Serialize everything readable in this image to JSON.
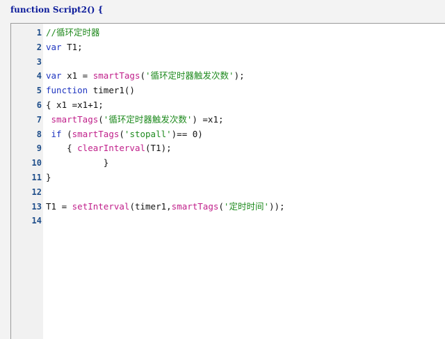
{
  "header": {
    "title": "function Script2() {"
  },
  "editor": {
    "lines": [
      {
        "n": "1",
        "tokens": [
          {
            "t": "//循环定时器",
            "c": "cm"
          }
        ]
      },
      {
        "n": "2",
        "tokens": [
          {
            "t": "var",
            "c": "kw"
          },
          {
            "t": " T1;",
            "c": ""
          }
        ]
      },
      {
        "n": "3",
        "tokens": []
      },
      {
        "n": "4",
        "tokens": [
          {
            "t": "var",
            "c": "kw"
          },
          {
            "t": " x1 = ",
            "c": ""
          },
          {
            "t": "smartTags",
            "c": "fn"
          },
          {
            "t": "(",
            "c": ""
          },
          {
            "t": "'循环定时器触发次数'",
            "c": "st"
          },
          {
            "t": ");",
            "c": ""
          }
        ]
      },
      {
        "n": "5",
        "tokens": [
          {
            "t": "function",
            "c": "kw"
          },
          {
            "t": " timer1()",
            "c": ""
          }
        ]
      },
      {
        "n": "6",
        "tokens": [
          {
            "t": "{ x1 =x1+1;",
            "c": ""
          }
        ]
      },
      {
        "n": "7",
        "tokens": [
          {
            "t": " ",
            "c": ""
          },
          {
            "t": "smartTags",
            "c": "fn"
          },
          {
            "t": "(",
            "c": ""
          },
          {
            "t": "'循环定时器触发次数'",
            "c": "st"
          },
          {
            "t": ") =x1;",
            "c": ""
          }
        ]
      },
      {
        "n": "8",
        "tokens": [
          {
            "t": " ",
            "c": ""
          },
          {
            "t": "if",
            "c": "kw"
          },
          {
            "t": " (",
            "c": ""
          },
          {
            "t": "smartTags",
            "c": "fn"
          },
          {
            "t": "(",
            "c": ""
          },
          {
            "t": "'stopall'",
            "c": "st"
          },
          {
            "t": ")== 0)",
            "c": ""
          }
        ]
      },
      {
        "n": "9",
        "tokens": [
          {
            "t": "    { ",
            "c": ""
          },
          {
            "t": "clearInterval",
            "c": "fn"
          },
          {
            "t": "(T1);",
            "c": ""
          }
        ]
      },
      {
        "n": "10",
        "tokens": [
          {
            "t": "           }",
            "c": ""
          }
        ]
      },
      {
        "n": "11",
        "tokens": [
          {
            "t": "}",
            "c": ""
          }
        ]
      },
      {
        "n": "12",
        "tokens": []
      },
      {
        "n": "13",
        "tokens": [
          {
            "t": "T1 = ",
            "c": ""
          },
          {
            "t": "setInterval",
            "c": "fn"
          },
          {
            "t": "(timer1,",
            "c": ""
          },
          {
            "t": "smartTags",
            "c": "fn"
          },
          {
            "t": "(",
            "c": ""
          },
          {
            "t": "'定时时间'",
            "c": "st"
          },
          {
            "t": "));",
            "c": ""
          }
        ]
      },
      {
        "n": "14",
        "tokens": []
      }
    ]
  }
}
